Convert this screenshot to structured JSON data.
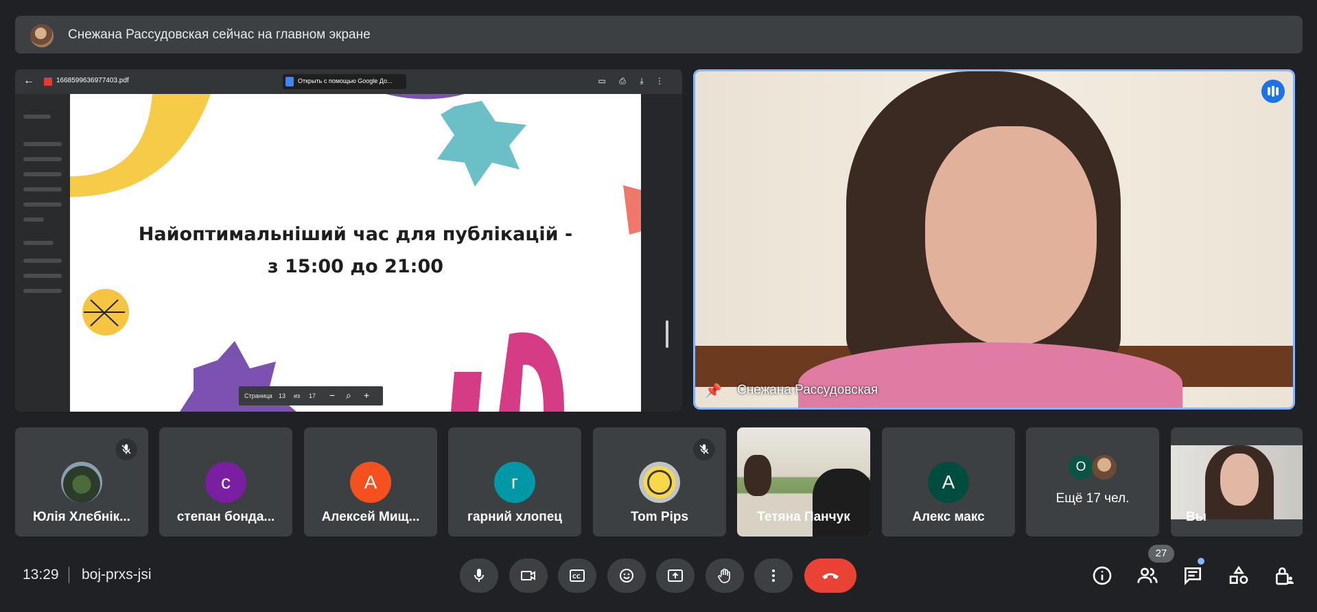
{
  "banner": {
    "text": "Снежана Рассудовская сейчас на главном экране"
  },
  "presentation": {
    "file_name": "1668599636977403.pdf",
    "open_with_label": "Открыть с помощью Google До...",
    "slide_line1": "Найоптимальніший час для публікацій -",
    "slide_line2": "з 15:00 до 21:00",
    "page_label": "Страница",
    "page_current": "13",
    "page_of": "из",
    "page_total": "17"
  },
  "main_video": {
    "name": "Снежана Рассудовская"
  },
  "participants": [
    {
      "name": "Юлія Хлєбнік...",
      "type": "photo",
      "muted": true
    },
    {
      "name": "степан бонда...",
      "initial": "с",
      "color": "#7b1fa2",
      "muted": false
    },
    {
      "name": "Алексей Мищ...",
      "initial": "А",
      "color": "#f4511e",
      "muted": false
    },
    {
      "name": "гарний хлопец",
      "initial": "г",
      "color": "#0097a7",
      "muted": false
    },
    {
      "name": "Tom Pips",
      "type": "photo",
      "muted": true
    },
    {
      "name": "Тетяна Панчук",
      "type": "video",
      "muted": false
    },
    {
      "name": "Алекс макс",
      "initial": "А",
      "color": "#004d40",
      "muted": false
    },
    {
      "name": "Ещё 17 чел.",
      "initial": "О",
      "muted": false
    },
    {
      "name": "Вы",
      "type": "video",
      "muted": false
    }
  ],
  "meeting": {
    "time": "13:29",
    "code": "boj-prxs-jsi",
    "participant_count": "27"
  },
  "colors": {
    "accent": "#8ab4f8",
    "end_call": "#ea4335",
    "tile": "#3c4043",
    "background": "#202124"
  }
}
